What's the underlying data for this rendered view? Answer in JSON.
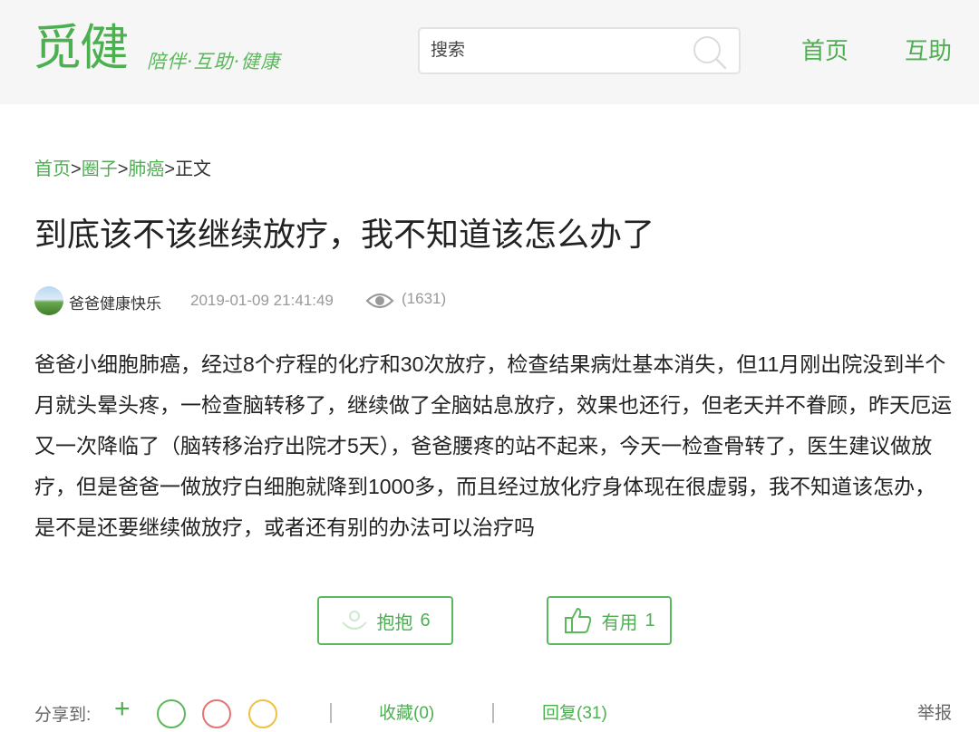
{
  "header": {
    "logo": "觅健",
    "slogan": "陪伴·互助·健康",
    "search_placeholder": "搜索",
    "nav": [
      {
        "label": "首页"
      },
      {
        "label": "互助"
      }
    ]
  },
  "breadcrumb": {
    "items": [
      "首页",
      "圈子",
      "肺癌"
    ],
    "separator": ">",
    "current": "正文"
  },
  "post": {
    "title": "到底该不该继续放疗，我不知道该怎么办了",
    "author": "爸爸健康快乐",
    "time": "2019-01-09 21:41:49",
    "views": "(1631)",
    "content": "爸爸小细胞肺癌，经过8个疗程的化疗和30次放疗，检查结果病灶基本消失，但11月刚出院没到半个月就头晕头疼，一检查脑转移了，继续做了全脑姑息放疗，效果也还行，但老天并不眷顾，昨天厄运又一次降临了（脑转移治疗出院才5天），爸爸腰疼的站不起来，今天一检查骨转了，医生建议做放疗，但是爸爸一做放疗白细胞就降到1000多，而且经过放化疗身体现在很虚弱，我不知道该怎办，是不是还要继续做放疗，或者还有别的办法可以治疗吗"
  },
  "actions": {
    "hug_label": "抱抱",
    "hug_count": "6",
    "useful_label": "有用",
    "useful_count": "1"
  },
  "share": {
    "label": "分享到:",
    "plus": "+",
    "collect": "收藏(0)",
    "reply": "回复(31)",
    "report": "举报"
  },
  "colors": {
    "brand_green": "#4caf50",
    "header_bg": "#f6f6f6",
    "meta_gray": "#999999"
  },
  "icons": [
    "search-icon",
    "eye-icon",
    "hug-icon",
    "thumbs-up-icon",
    "wechat-icon",
    "weibo-icon",
    "qzone-icon"
  ]
}
